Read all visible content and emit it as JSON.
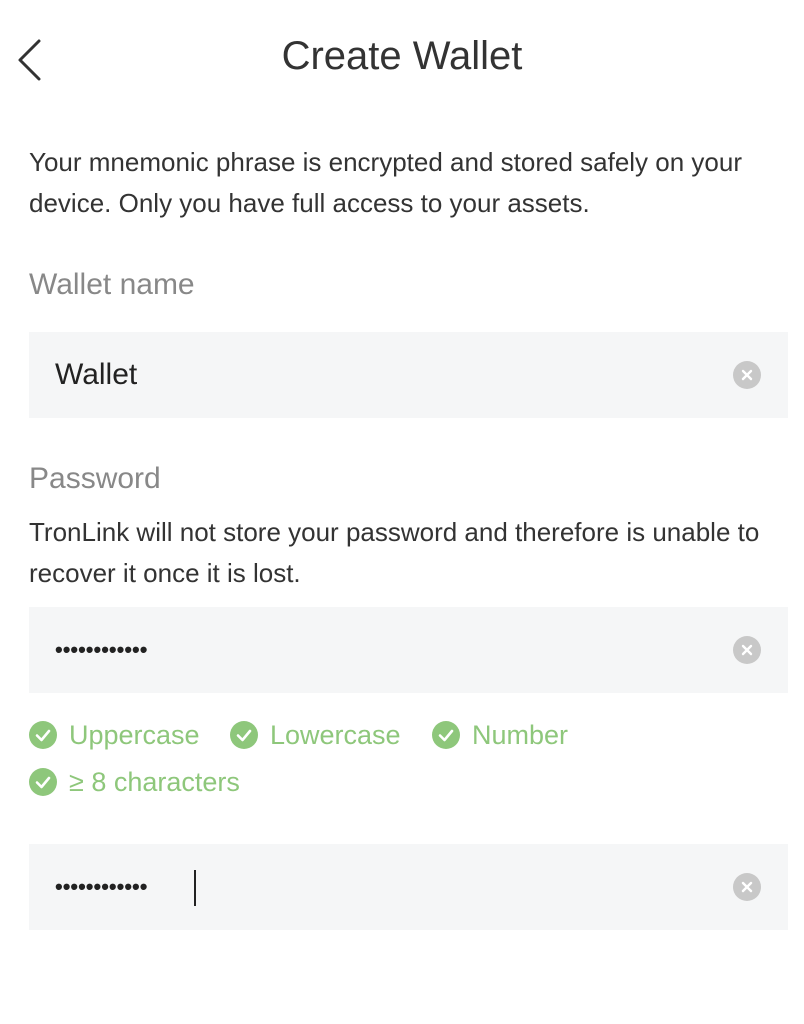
{
  "header": {
    "title": "Create Wallet"
  },
  "intro": {
    "text": "Your mnemonic phrase is encrypted and stored safely on your device. Only you have full access to your assets."
  },
  "wallet_name": {
    "label": "Wallet name",
    "value": "Wallet"
  },
  "password": {
    "label": "Password",
    "note": "TronLink will not store your password and therefore is unable to recover it once it is lost.",
    "value": "••••••••••••",
    "confirm_value": "••••••••••••"
  },
  "rules": [
    {
      "label": "Uppercase",
      "met": true
    },
    {
      "label": "Lowercase",
      "met": true
    },
    {
      "label": "Number",
      "met": true
    },
    {
      "label": "≥ 8 characters",
      "met": true
    }
  ],
  "colors": {
    "accent_green": "#8ec77b",
    "field_bg": "#f5f6f7",
    "label_gray": "#888888"
  },
  "icons": {
    "back": "chevron-left-icon",
    "clear": "clear-circle-icon",
    "check": "check-circle-icon"
  }
}
